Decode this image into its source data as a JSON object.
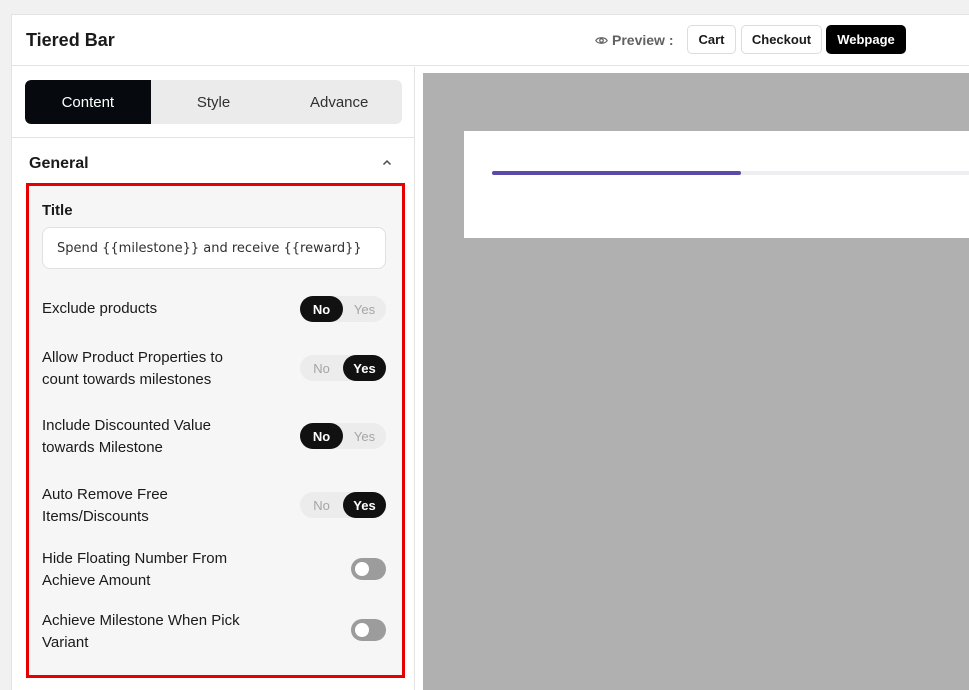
{
  "header": {
    "title": "Tiered Bar",
    "preview_label": "Preview :",
    "preview_buttons": [
      {
        "label": "Cart",
        "active": false
      },
      {
        "label": "Checkout",
        "active": false
      },
      {
        "label": "Webpage",
        "active": true
      }
    ]
  },
  "sidebar": {
    "tabs": [
      {
        "label": "Content",
        "active": true
      },
      {
        "label": "Style",
        "active": false
      },
      {
        "label": "Advance",
        "active": false
      }
    ],
    "section": {
      "title": "General",
      "expanded": true
    }
  },
  "settings": {
    "title_label": "Title",
    "title_value": "Spend {{milestone}} and receive {{reward}}",
    "exclude_products": {
      "label": "Exclude products",
      "no": "No",
      "yes": "Yes",
      "value": "No"
    },
    "allow_properties": {
      "label": "Allow Product Properties to count towards milestones",
      "no": "No",
      "yes": "Yes",
      "value": "Yes"
    },
    "include_discounted": {
      "label": "Include Discounted Value towards Milestone",
      "no": "No",
      "yes": "Yes",
      "value": "No"
    },
    "auto_remove": {
      "label": "Auto Remove Free Items/Discounts",
      "no": "No",
      "yes": "Yes",
      "value": "Yes"
    },
    "hide_floating": {
      "label": "Hide Floating Number From Achieve Amount",
      "enabled": false
    },
    "achieve_variant": {
      "label": "Achieve Milestone When Pick Variant",
      "enabled": false
    }
  },
  "preview": {
    "progress": 0.52,
    "bar_color": "#5b4aa8"
  },
  "colors": {
    "highlight_border": "#e60000",
    "active_tab": "#06090d"
  }
}
